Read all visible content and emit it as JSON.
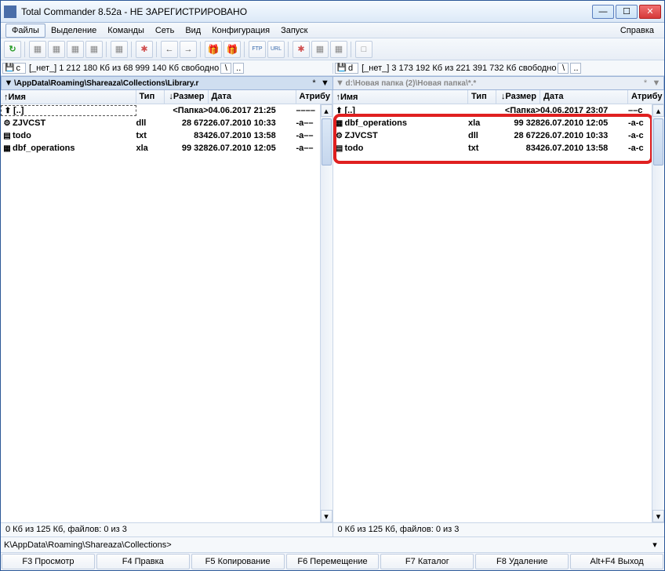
{
  "title": "Total Commander 8.52a - НЕ ЗАРЕГИСТРИРОВАНО",
  "menu": {
    "files": "Файлы",
    "mark": "Выделение",
    "commands": "Команды",
    "net": "Сеть",
    "view": "Вид",
    "config": "Конфигурация",
    "start": "Запуск",
    "help": "Справка"
  },
  "drive": {
    "left": {
      "letter": "c",
      "none": "[_нет_]",
      "info": "1 212 180 Кб из 68 999 140 Кб свободно"
    },
    "right": {
      "letter": "d",
      "none": "[_нет_]",
      "info": "3 173 192 Кб из 221 391 732 Кб свободно"
    }
  },
  "path": {
    "left": "\\AppData\\Roaming\\Shareaza\\Collections\\Library.r",
    "right": "d:\\Новая папка (2)\\Новая папка\\*.*"
  },
  "cols": {
    "name": "Имя",
    "ext": "Тип",
    "size": "Размер",
    "date": "Дата",
    "attr": "Атрибу"
  },
  "left_rows": [
    {
      "icon": "⬆",
      "name": "[..]",
      "ext": "",
      "size": "<Папка>",
      "date": "04.06.2017 21:25",
      "attr": "––––"
    },
    {
      "icon": "⚙",
      "name": "ZJVCST",
      "ext": "dll",
      "size": "28 672",
      "date": "26.07.2010 10:33",
      "attr": "-a––"
    },
    {
      "icon": "▤",
      "name": "todo",
      "ext": "txt",
      "size": "834",
      "date": "26.07.2010 13:58",
      "attr": "-a––"
    },
    {
      "icon": "▦",
      "name": "dbf_operations",
      "ext": "xla",
      "size": "99 328",
      "date": "26.07.2010 12:05",
      "attr": "-a––"
    }
  ],
  "right_rows": [
    {
      "icon": "⬆",
      "name": "[..]",
      "ext": "",
      "size": "<Папка>",
      "date": "04.06.2017 23:07",
      "attr": "––c"
    },
    {
      "icon": "▦",
      "name": "dbf_operations",
      "ext": "xla",
      "size": "99 328",
      "date": "26.07.2010 12:05",
      "attr": "-a-c"
    },
    {
      "icon": "⚙",
      "name": "ZJVCST",
      "ext": "dll",
      "size": "28 672",
      "date": "26.07.2010 10:33",
      "attr": "-a-c"
    },
    {
      "icon": "▤",
      "name": "todo",
      "ext": "txt",
      "size": "834",
      "date": "26.07.2010 13:58",
      "attr": "-a-c"
    }
  ],
  "status": {
    "left": "0 Кб из 125 Кб, файлов: 0 из 3",
    "right": "0 Кб из 125 Кб, файлов: 0 из 3"
  },
  "cmd": "K\\AppData\\Roaming\\Shareaza\\Collections>",
  "fkeys": {
    "f3": "F3 Просмотр",
    "f4": "F4 Правка",
    "f5": "F5 Копирование",
    "f6": "F6 Перемещение",
    "f7": "F7 Каталог",
    "f8": "F8 Удаление",
    "altf4": "Alt+F4 Выход"
  }
}
